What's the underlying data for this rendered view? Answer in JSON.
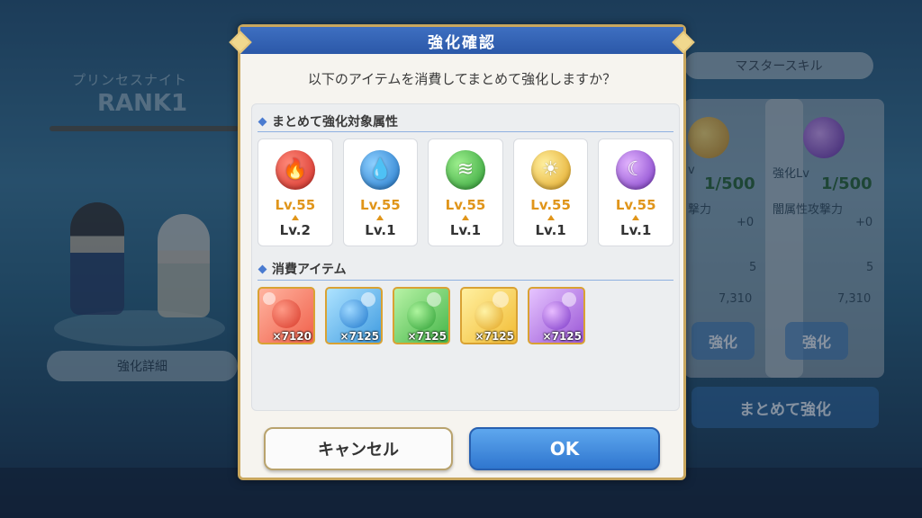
{
  "background": {
    "left_title": "プリンセスナイト",
    "rank": "RANK1",
    "detail_button": "強化詳細",
    "master_skill_tab": "マスタースキル",
    "panels": [
      {
        "lv_label": "v",
        "progress": "1/500",
        "stat": "撃力",
        "plus": "+0",
        "val1": "5",
        "val2": "7,310",
        "button": "強化"
      },
      {
        "lv_label": "強化Lv",
        "progress": "1/500",
        "stat": "闇属性攻撃力",
        "plus": "+0",
        "val1": "5",
        "val2": "7,310",
        "button": "強化"
      }
    ],
    "batch_button": "まとめて強化"
  },
  "dialog": {
    "title": "強化確認",
    "message": "以下のアイテムを消費してまとめて強化しますか？",
    "attributes_label": "まとめて強化対象属性",
    "attributes": [
      {
        "element": "fire",
        "icon": "fire-icon",
        "glyph": "🔥",
        "max": "Lv.55",
        "current": "Lv.2"
      },
      {
        "element": "water",
        "icon": "water-drop-icon",
        "glyph": "💧",
        "max": "Lv.55",
        "current": "Lv.1"
      },
      {
        "element": "wind",
        "icon": "wind-icon",
        "glyph": "≋",
        "max": "Lv.55",
        "current": "Lv.1"
      },
      {
        "element": "light",
        "icon": "sun-icon",
        "glyph": "☀",
        "max": "Lv.55",
        "current": "Lv.1"
      },
      {
        "element": "dark",
        "icon": "moon-icon",
        "glyph": "☾",
        "max": "Lv.55",
        "current": "Lv.1"
      }
    ],
    "items_label": "消費アイテム",
    "items": [
      {
        "element": "fire",
        "count": "×7120"
      },
      {
        "element": "water",
        "count": "×7125"
      },
      {
        "element": "wind",
        "count": "×7125"
      },
      {
        "element": "light",
        "count": "×7125"
      },
      {
        "element": "dark",
        "count": "×7125"
      }
    ],
    "cancel_button": "キャンセル",
    "ok_button": "OK"
  },
  "colors": {
    "header_blue": "#2b58a8",
    "level_orange": "#e0951a",
    "ok_blue": "#2f76cf",
    "border_gold": "#c9a75e"
  }
}
